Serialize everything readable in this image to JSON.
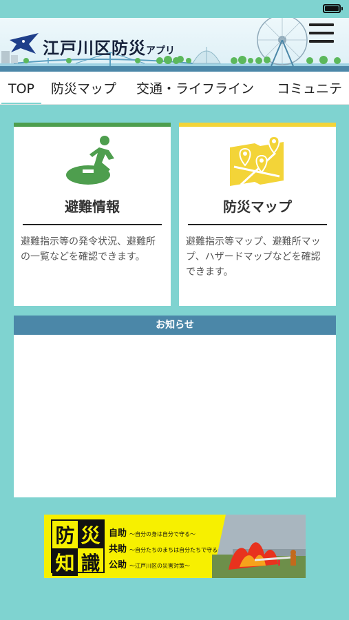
{
  "header": {
    "title_main": "江戸川区防災",
    "title_suffix": "アプリ"
  },
  "tabs": [
    {
      "label": "TOP",
      "active": true
    },
    {
      "label": "防災マップ",
      "active": false
    },
    {
      "label": "交通・ライフライン",
      "active": false
    },
    {
      "label": "コミュニテ",
      "active": false
    }
  ],
  "cards": [
    {
      "title": "避難情報",
      "description": "避難指示等の発令状況、避難所の一覧などを確認できます。",
      "icon": "evacuation-icon",
      "accent": "#4e9e4e"
    },
    {
      "title": "防災マップ",
      "description": "避難指示等マップ、避難所マップ、ハザードマップなどを確認できます。",
      "icon": "map-pins-icon",
      "accent": "#f3d438"
    }
  ],
  "notice": {
    "title": "お知らせ"
  },
  "banner": {
    "grid": [
      "防",
      "災",
      "知",
      "識"
    ],
    "lines": [
      {
        "label": "自助",
        "sub": "〜自分の身は自分で守る〜"
      },
      {
        "label": "共助",
        "sub": "〜自分たちのまちは自分たちで守る〜"
      },
      {
        "label": "公助",
        "sub": "〜江戸川区の災害対策〜"
      }
    ]
  },
  "colors": {
    "background": "#7fd3d0",
    "notice_header": "#4b87a8",
    "banner_yellow": "#f7f000"
  }
}
